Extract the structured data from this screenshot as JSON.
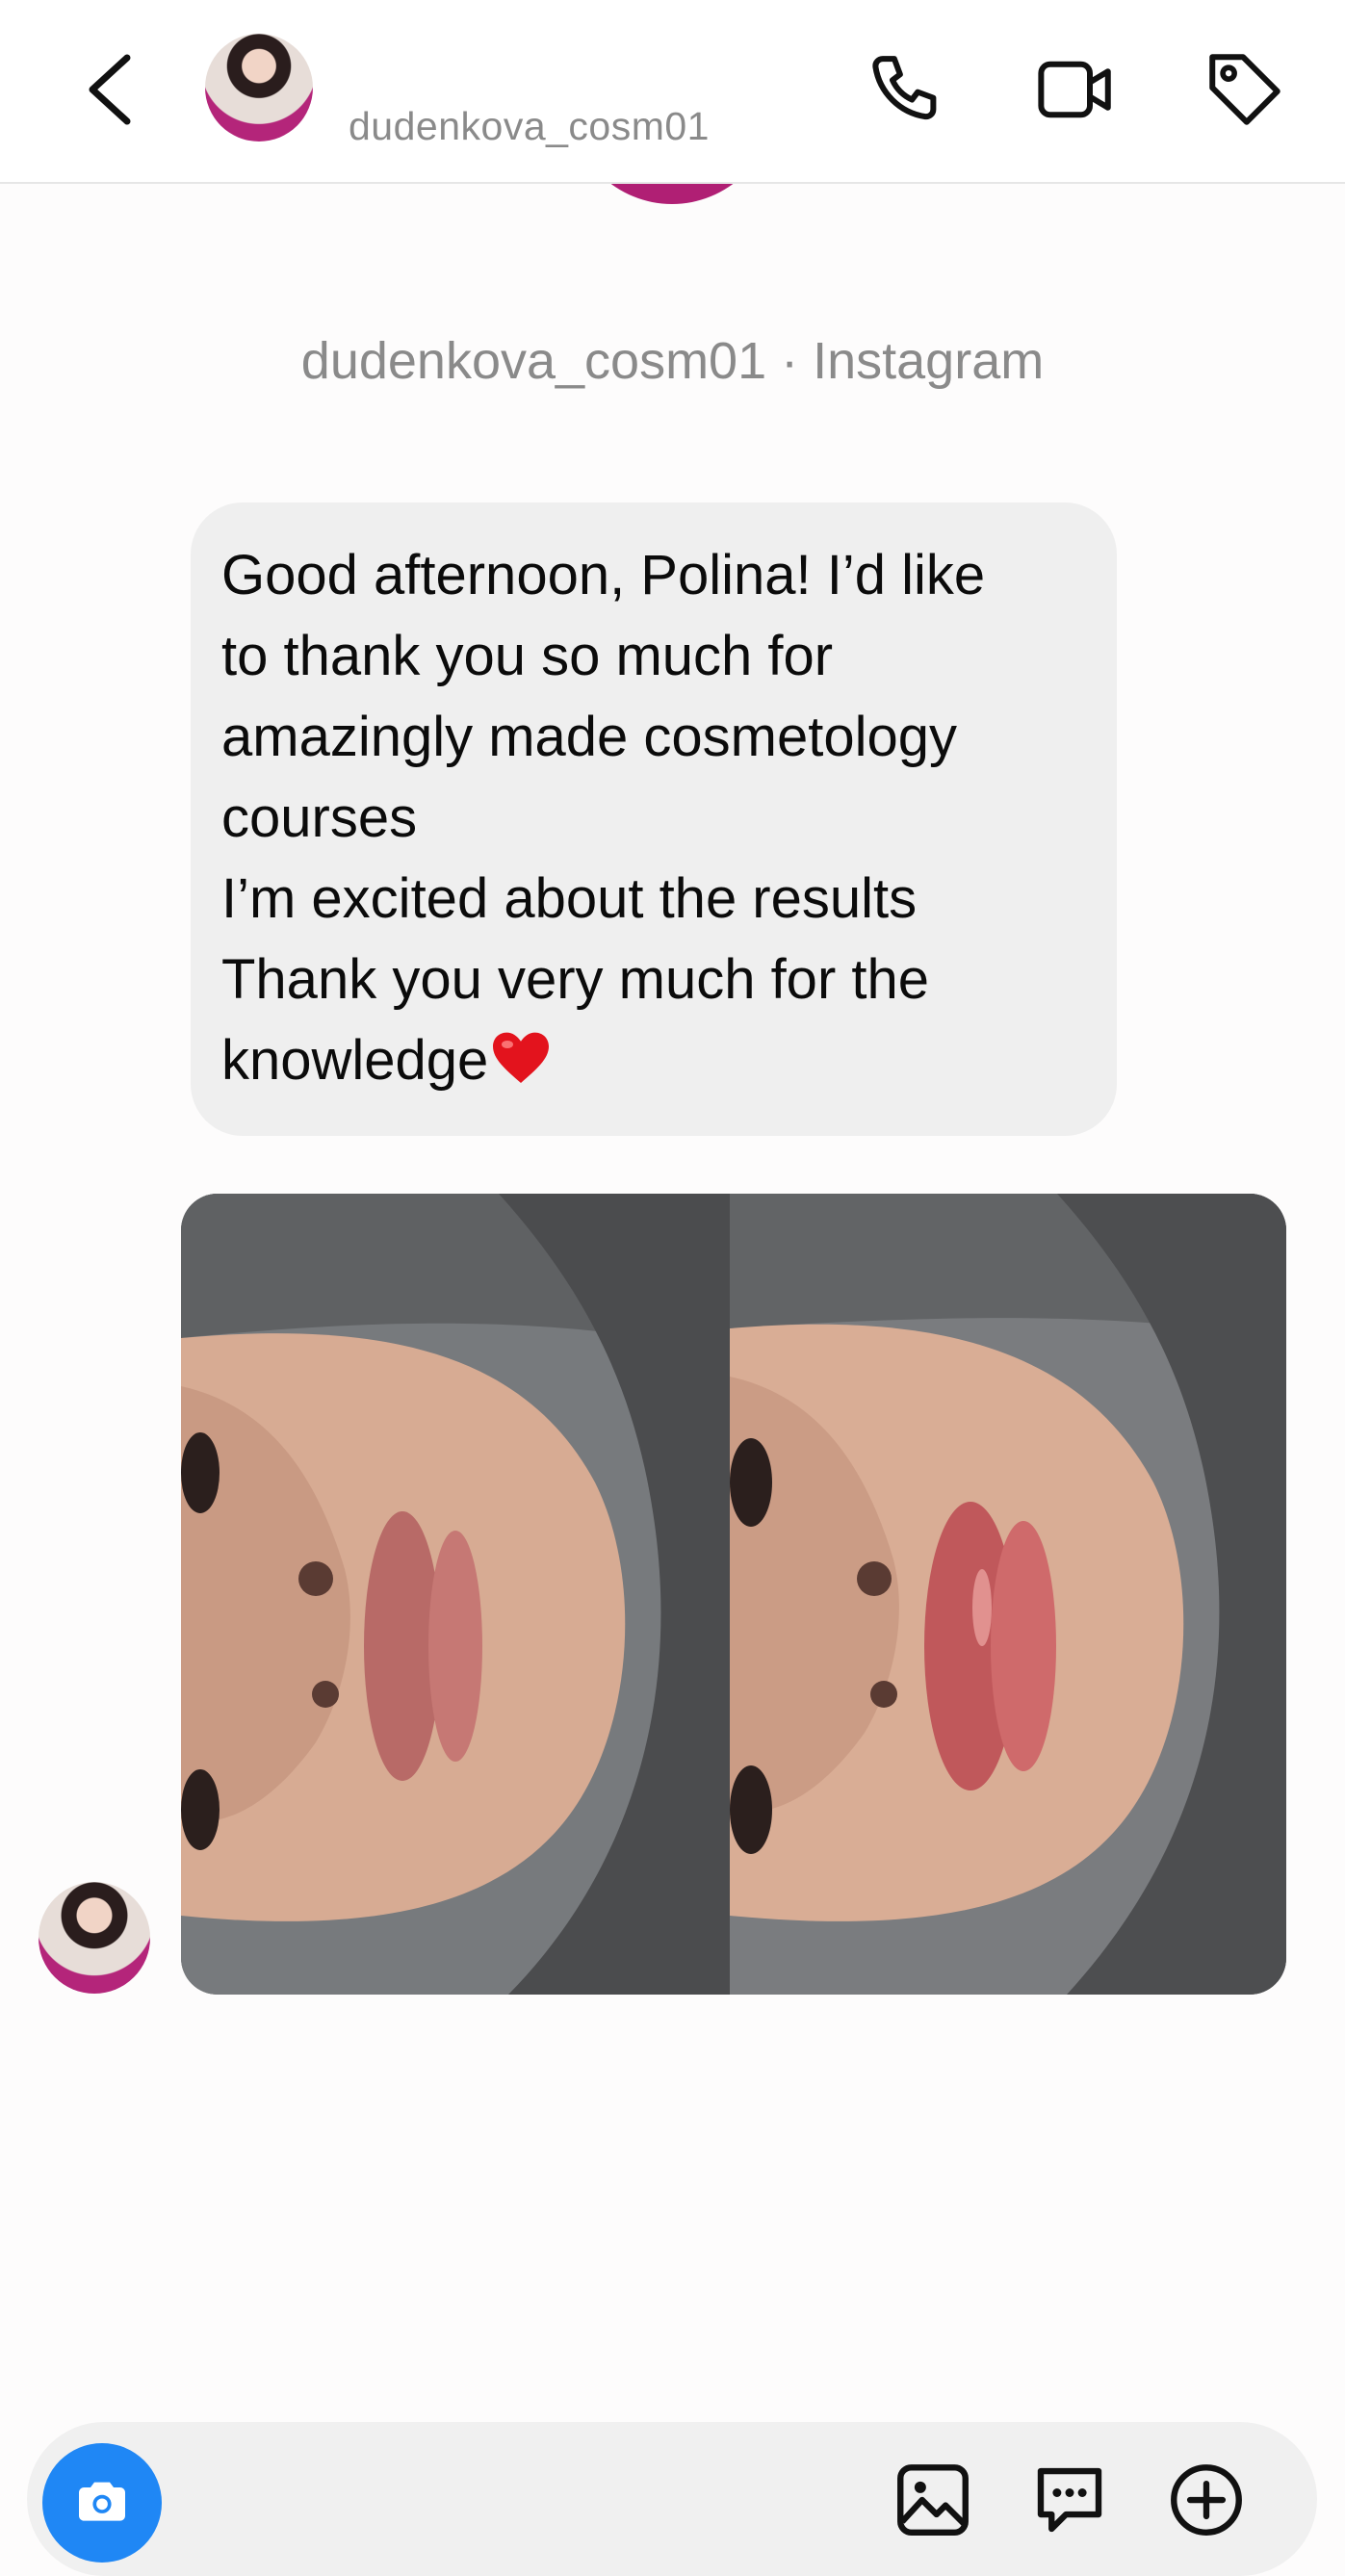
{
  "header": {
    "username": "dudenkova_cosm01",
    "icons": [
      "back-icon",
      "phone-icon",
      "video-camera-icon",
      "tag-icon"
    ]
  },
  "profile": {
    "caption": "dudenkova_cosm01 · Instagram"
  },
  "message": {
    "lines": [
      "Good afternoon, Polina! I’d like",
      "to thank you so much for",
      "amazingly made cosmetology",
      "courses",
      "I’m excited about the results",
      "Thank you very much for the",
      "knowledge"
    ],
    "emoji": "heart-emoji"
  },
  "photo": {
    "description_icon": "lips-before-after-photo"
  },
  "composer": {
    "icons": [
      "camera-icon",
      "gallery-icon",
      "sticker-icon",
      "plus-icon"
    ],
    "camera_color": "#1f87f5"
  }
}
